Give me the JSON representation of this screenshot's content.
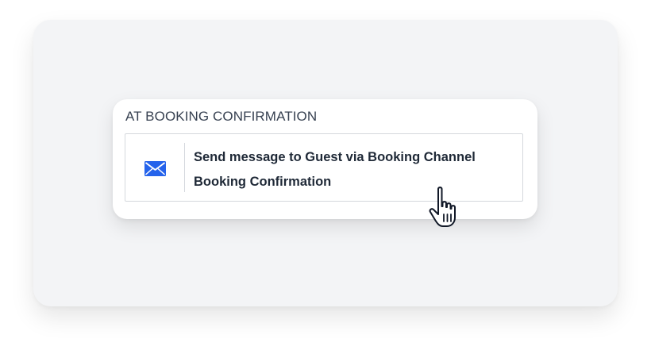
{
  "section": {
    "title": "AT BOOKING CONFIRMATION"
  },
  "action": {
    "icon": "envelope-icon",
    "line1": "Send message to Guest via Booking Channel",
    "line2": "Booking Confirmation"
  },
  "colors": {
    "accent": "#2563eb",
    "text": "#1f2937",
    "panel": "#f3f4f6"
  },
  "cursor": {
    "icon": "pointer-hand-icon"
  }
}
